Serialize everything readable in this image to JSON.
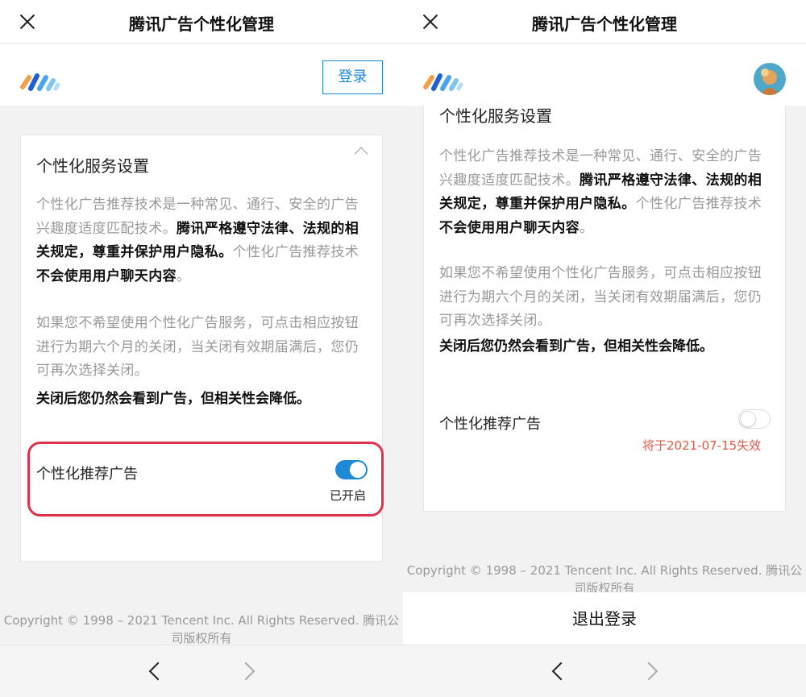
{
  "title": "腾讯广告个性化管理",
  "login_label": "登录",
  "section_title": "个性化服务设置",
  "para1": {
    "part1": "个性化广告推荐技术是一种常见、通行、安全的广告兴趣度适度匹配技术。",
    "bold1": "腾讯严格遵守法律、法规的相关规定，尊重并保护用户隐私。",
    "part2": "个性化广告推荐技术",
    "bold2": "不会使用用户聊天内容",
    "part3": "。"
  },
  "para2": "如果您不希望使用个性化广告服务，可点击相应按钮进行为期六个月的关闭，当关闭有效期届满后，您仍可再次选择关闭。",
  "para2_bold": "关闭后您仍然会看到广告，但相关性会降低。",
  "toggle_label": "个性化推荐广告",
  "left_status": "已开启",
  "right_status": "将于2021-07-15失效",
  "copyright": "Copyright © 1998 – 2021 Tencent Inc. All Rights Reserved. 腾讯公司版权所有",
  "logout_label": "退出登录",
  "colors": {
    "accent": "#1e8ad6",
    "highlight": "#e0304a",
    "expiry": "#e05a4a"
  },
  "icons": [
    "close-icon",
    "logo-icon",
    "chevron-up-icon",
    "back-arrow-icon",
    "forward-arrow-icon"
  ]
}
